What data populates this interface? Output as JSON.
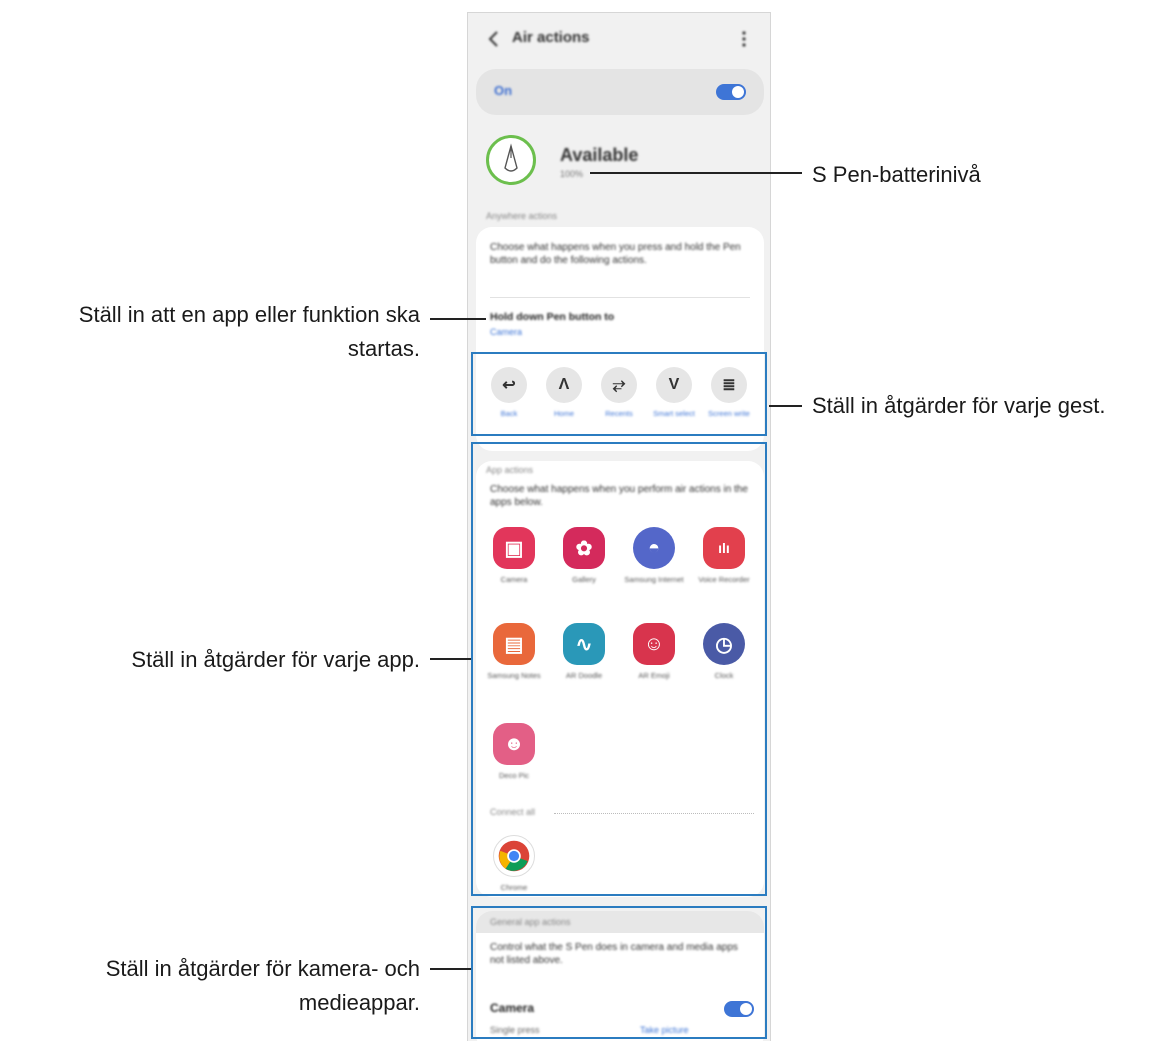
{
  "screen": {
    "title": "Air actions",
    "on_label": "On",
    "pen": {
      "status": "Available",
      "sub": "100%"
    },
    "anywhere_header": "Anywhere actions",
    "anywhere_desc": "Choose what happens when you press and hold the Pen button and do the following actions.",
    "hold_label": "Hold down Pen button to",
    "hold_value": "Camera",
    "gestures": [
      {
        "glyph": "↩",
        "label": "Back"
      },
      {
        "glyph": "Λ",
        "label": "Home"
      },
      {
        "glyph": "⥂",
        "label": "Recents"
      },
      {
        "glyph": "V",
        "label": "Smart select"
      },
      {
        "glyph": "≣",
        "label": "Screen write"
      }
    ],
    "app_header": "App actions",
    "app_desc": "Choose what happens when you perform air actions in the apps below.",
    "apps": [
      {
        "label": "Camera",
        "color": "#e2365b",
        "glyph": "▣"
      },
      {
        "label": "Gallery",
        "color": "#d42a5c",
        "glyph": "✿"
      },
      {
        "label": "Samsung Internet",
        "color": "#5467c9",
        "glyph": "◓"
      },
      {
        "label": "Voice Recorder",
        "color": "#e2404d",
        "glyph": "ılı"
      },
      {
        "label": "Samsung Notes",
        "color": "#e9683b",
        "glyph": "▤"
      },
      {
        "label": "AR Doodle",
        "color": "#2a98b8",
        "glyph": "∿"
      },
      {
        "label": "AR Emoji",
        "color": "#d8344d",
        "glyph": "☺"
      },
      {
        "label": "Clock",
        "color": "#4a5aa6",
        "glyph": "◷"
      },
      {
        "label": "Deco Pic",
        "color": "#e35f86",
        "glyph": "☻"
      }
    ],
    "general_header": "Connect all",
    "chrome_label": "Chrome",
    "general_app_header": "General app actions",
    "general_desc": "Control what the S Pen does in camera and media apps not listed above.",
    "camera_label": "Camera",
    "single_press": "Single press",
    "take_picture": "Take picture"
  },
  "callouts": {
    "battery": "S Pen-batterinivå",
    "launch_line1": "Ställ in att en app eller funktion ska",
    "launch_line2": "startas.",
    "gesture": "Ställ in åtgärder för varje gest.",
    "app": "Ställ in åtgärder för varje app.",
    "camera_line1": "Ställ in åtgärder för kamera- och",
    "camera_line2": "medieappar."
  },
  "colors": {
    "accent": "#3e75d6",
    "highlight_box": "#2b7cc0",
    "battery_ring": "#6cbf4d"
  }
}
